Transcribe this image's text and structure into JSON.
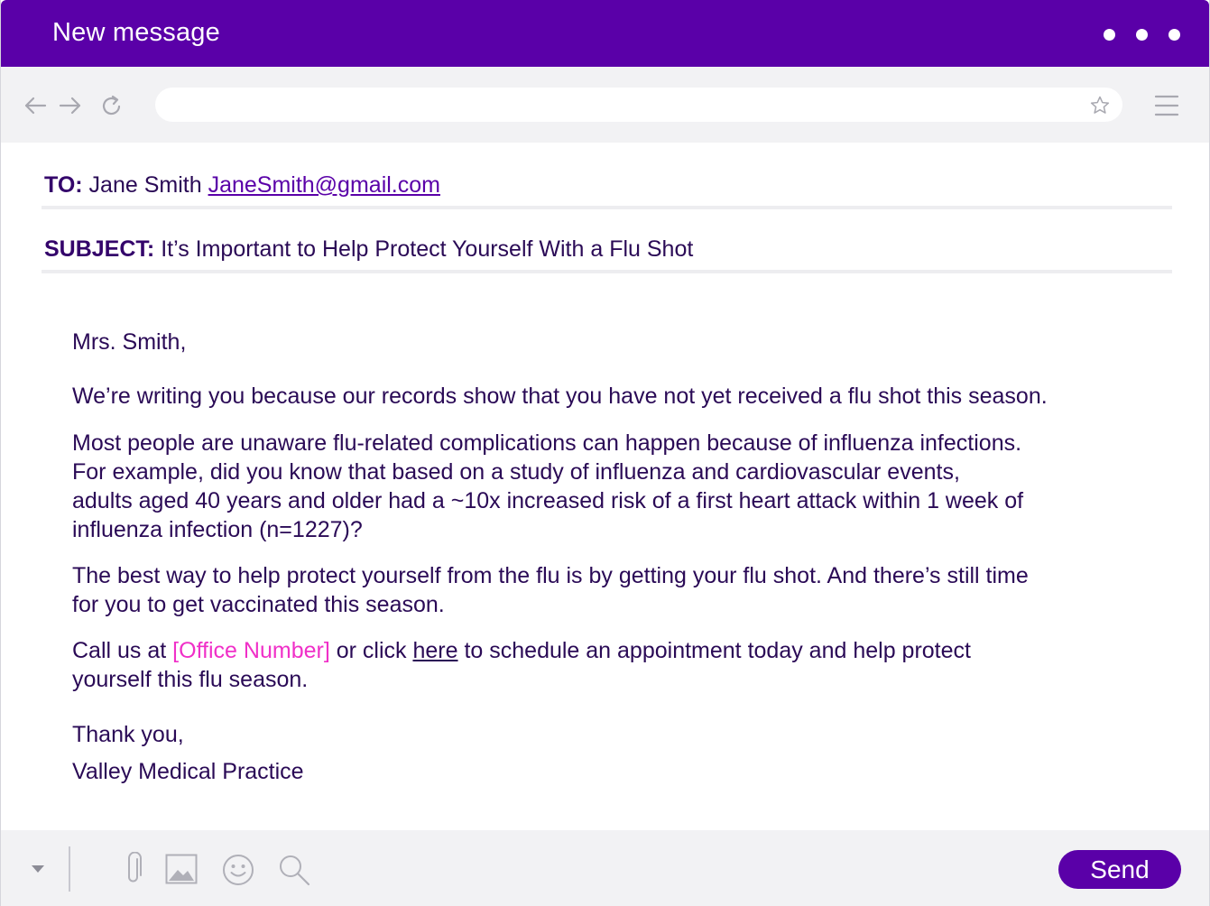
{
  "window": {
    "title": "New message"
  },
  "browser": {
    "url_value": "",
    "icons": [
      "back-arrow-icon",
      "forward-arrow-icon",
      "reload-icon",
      "star-icon",
      "menu-icon"
    ]
  },
  "compose": {
    "to_label": "TO:",
    "to_name": "Jane Smith",
    "to_email": "JaneSmith@gmail.com",
    "subject_label": "SUBJECT:",
    "subject": "It’s Important to Help Protect Yourself With a Flu Shot"
  },
  "body": {
    "greeting": "Mrs. Smith,",
    "p1": "We’re writing you because our records show that you have not yet received a flu shot this season.",
    "p2_lines": [
      "Most people are unaware flu-related complications can happen because of influenza infections.",
      "For example, did you know that based on a study of influenza and cardiovascular events,",
      "adults aged 40 years and older had a ~10x increased risk of a first heart attack within 1 week of",
      "influenza infection (n=1227)?"
    ],
    "p3_lines": [
      "The best way to help protect yourself from the flu is by getting your flu shot. And there’s still time",
      "for you to get vaccinated this season."
    ],
    "p4_prefix": "Call us at ",
    "p4_office": "[Office Number]",
    "p4_mid": " or click ",
    "p4_link": "here",
    "p4_suffix": " to schedule an appointment today and help protect",
    "p4_line2": "yourself this flu season.",
    "closing": "Thank you,",
    "signature": "Valley Medical Practice"
  },
  "footer": {
    "send_label": "Send",
    "icons": [
      "dropdown-caret-icon",
      "paperclip-icon",
      "image-icon",
      "emoji-icon",
      "search-icon"
    ]
  },
  "colors": {
    "brand": "#5a00a8",
    "text": "#2a0a56",
    "highlight": "#f030c8"
  }
}
